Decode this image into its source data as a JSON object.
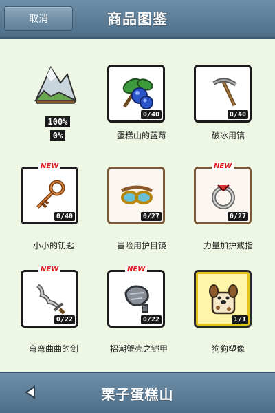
{
  "header": {
    "cancel_label": "取消",
    "title": "商品图鉴"
  },
  "landmark": {
    "percent": "100%",
    "percent2": "0%",
    "icon": "mountain-icon"
  },
  "items": [
    {
      "name": "蛋糕山的蓝莓",
      "count": "0/40",
      "is_new": false,
      "frame": "black",
      "icon": "blueberry-icon"
    },
    {
      "name": "破冰用镐",
      "count": "0/40",
      "is_new": false,
      "frame": "black",
      "icon": "pickaxe-icon"
    },
    {
      "name": "小小的钥匙",
      "count": "0/40",
      "is_new": true,
      "frame": "black",
      "icon": "key-icon"
    },
    {
      "name": "冒险用护目镜",
      "count": "0/27",
      "is_new": false,
      "frame": "brown",
      "icon": "goggles-icon"
    },
    {
      "name": "力量加护戒指",
      "count": "0/27",
      "is_new": true,
      "frame": "brown",
      "icon": "ring-icon"
    },
    {
      "name": "弯弯曲曲的剑",
      "count": "0/22",
      "is_new": true,
      "frame": "black",
      "icon": "sword-icon"
    },
    {
      "name": "招潮蟹壳之铠甲",
      "count": "0/22",
      "is_new": true,
      "frame": "black",
      "icon": "armor-icon"
    },
    {
      "name": "狗狗塑像",
      "count": "1/1",
      "is_new": false,
      "frame": "gold",
      "icon": "dog-statue-icon"
    }
  ],
  "new_label": "NEW",
  "footer": {
    "title": "栗子蛋糕山",
    "back_icon": "left-arrow-icon"
  },
  "colors": {
    "header": "#5f7f98",
    "background": "#eef7e4",
    "new": "#e01b1b",
    "gold_frame": "#e6c21c"
  }
}
